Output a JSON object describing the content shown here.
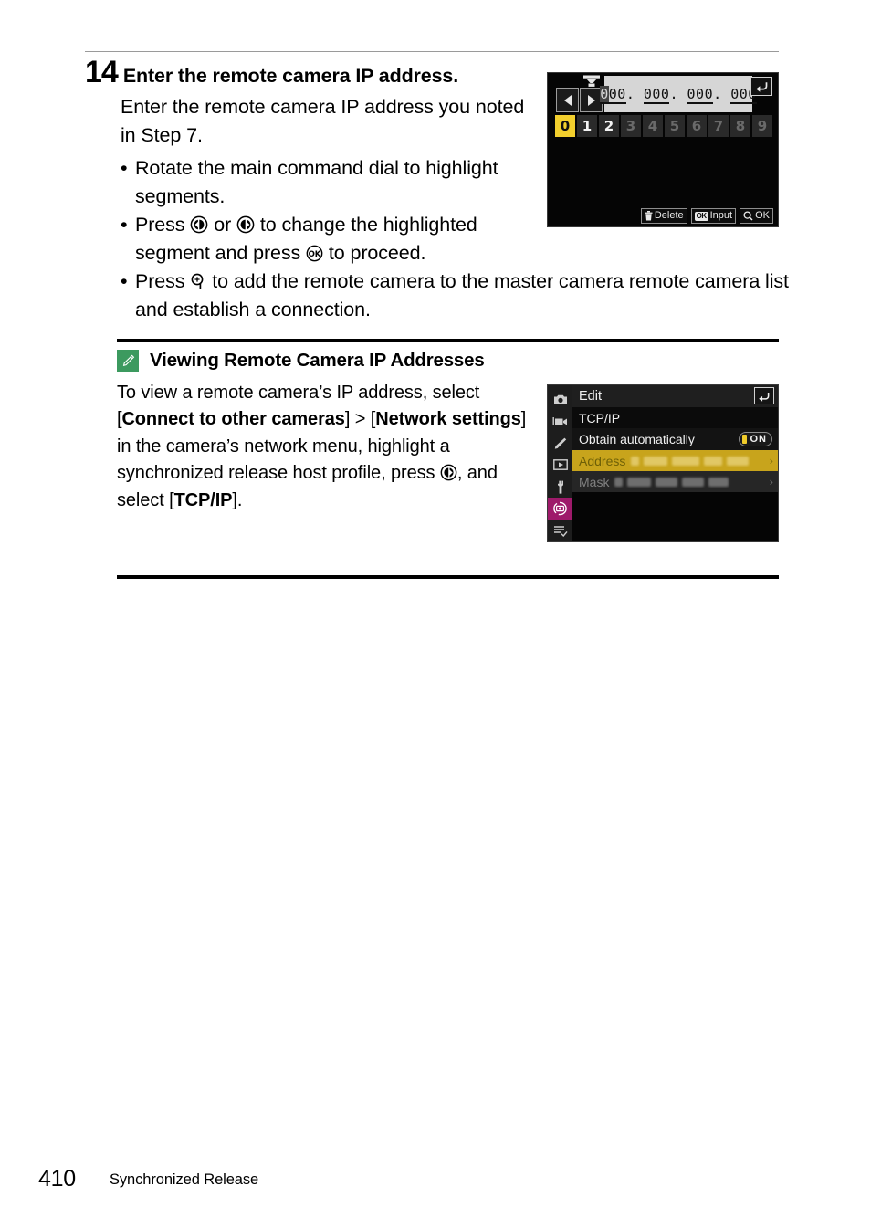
{
  "page": {
    "number": "410",
    "running_head": "Synchronized Release"
  },
  "step": {
    "number": "14",
    "title": "Enter the remote camera IP address.",
    "intro": "Enter the remote camera IP address you noted in Step 7.",
    "bullet_marker": "•",
    "bullets": [
      {
        "before": "Rotate the main command dial to highlight segments.",
        "after": "",
        "middle": "",
        "icons": []
      },
      {
        "before": "Press ",
        "icon1": "multi-selector-left-icon",
        "mid1": " or ",
        "icon2": "multi-selector-right-icon",
        "mid2": " to change the highlighted segment and press ",
        "icon3": "ok-button-icon",
        "after": " to proceed."
      },
      {
        "before": "Press ",
        "icon1": "zoom-in-magnifier-icon",
        "after": " to add the remote camera to the master camera remote camera list and establish a connection."
      }
    ]
  },
  "note": {
    "icon": "pencil-note-icon",
    "icon_color": "#3c9a5f",
    "title": "Viewing Remote Camera IP Addresses",
    "text_parts": {
      "p1": "To view a remote camera’s IP address, select [",
      "b1": "Connect to other cameras",
      "p2": "] > [",
      "b2": "Network settings",
      "p3": "] in the camera’s network menu, highlight a synchronized release host profile, press ",
      "icon": "multi-selector-right-icon",
      "p4": ", and select [",
      "b3": "TCP/IP",
      "p5": "]."
    }
  },
  "screen_ip_entry": {
    "name": "ip-address-entry-screen",
    "keyboard_icon": "text-entry-icon",
    "left_arrow": "◀",
    "right_arrow": "▶",
    "back_icon": "↶",
    "ip_value": "000.000.000.000",
    "octets": [
      "000",
      "000",
      "000",
      "000"
    ],
    "cursor_digit": "0",
    "separator": ".",
    "number_keys": [
      {
        "label": "0",
        "state": "selected"
      },
      {
        "label": "1",
        "state": "bright"
      },
      {
        "label": "2",
        "state": "bright"
      },
      {
        "label": "3",
        "state": "dim"
      },
      {
        "label": "4",
        "state": "dim"
      },
      {
        "label": "5",
        "state": "dim"
      },
      {
        "label": "6",
        "state": "dim"
      },
      {
        "label": "7",
        "state": "dim"
      },
      {
        "label": "8",
        "state": "dim"
      },
      {
        "label": "9",
        "state": "dim"
      }
    ],
    "hints": [
      {
        "icon": "trash-icon",
        "label": "Delete"
      },
      {
        "icon": "ok-badge",
        "badge": "OK",
        "label": "Input"
      },
      {
        "icon": "magnifier-icon",
        "label": "OK"
      }
    ],
    "highlight_color": "#f2cf2d"
  },
  "screen_tcpip": {
    "name": "tcpip-edit-screen",
    "sidebar_icons": [
      "photo-shooting-menu-icon",
      "movie-shooting-menu-icon",
      "custom-settings-menu-icon",
      "playback-menu-icon",
      "setup-menu-icon",
      "network-menu-icon",
      "my-menu-icon"
    ],
    "active_sidebar_index": 5,
    "active_sidebar_color": "#9e1a6a",
    "header": "Edit",
    "back_icon": "↶",
    "subheader": "TCP/IP",
    "rows": [
      {
        "label": "Obtain automatically",
        "value": "ON",
        "type": "toggle"
      },
      {
        "label": "Address",
        "value": "",
        "type": "link",
        "state": "highlighted"
      },
      {
        "label": "Mask",
        "value": "",
        "type": "link",
        "state": "dim"
      }
    ],
    "chevron": "›",
    "highlight_color": "#c8a41c",
    "toggle_pip_color": "#f0cc2a"
  }
}
